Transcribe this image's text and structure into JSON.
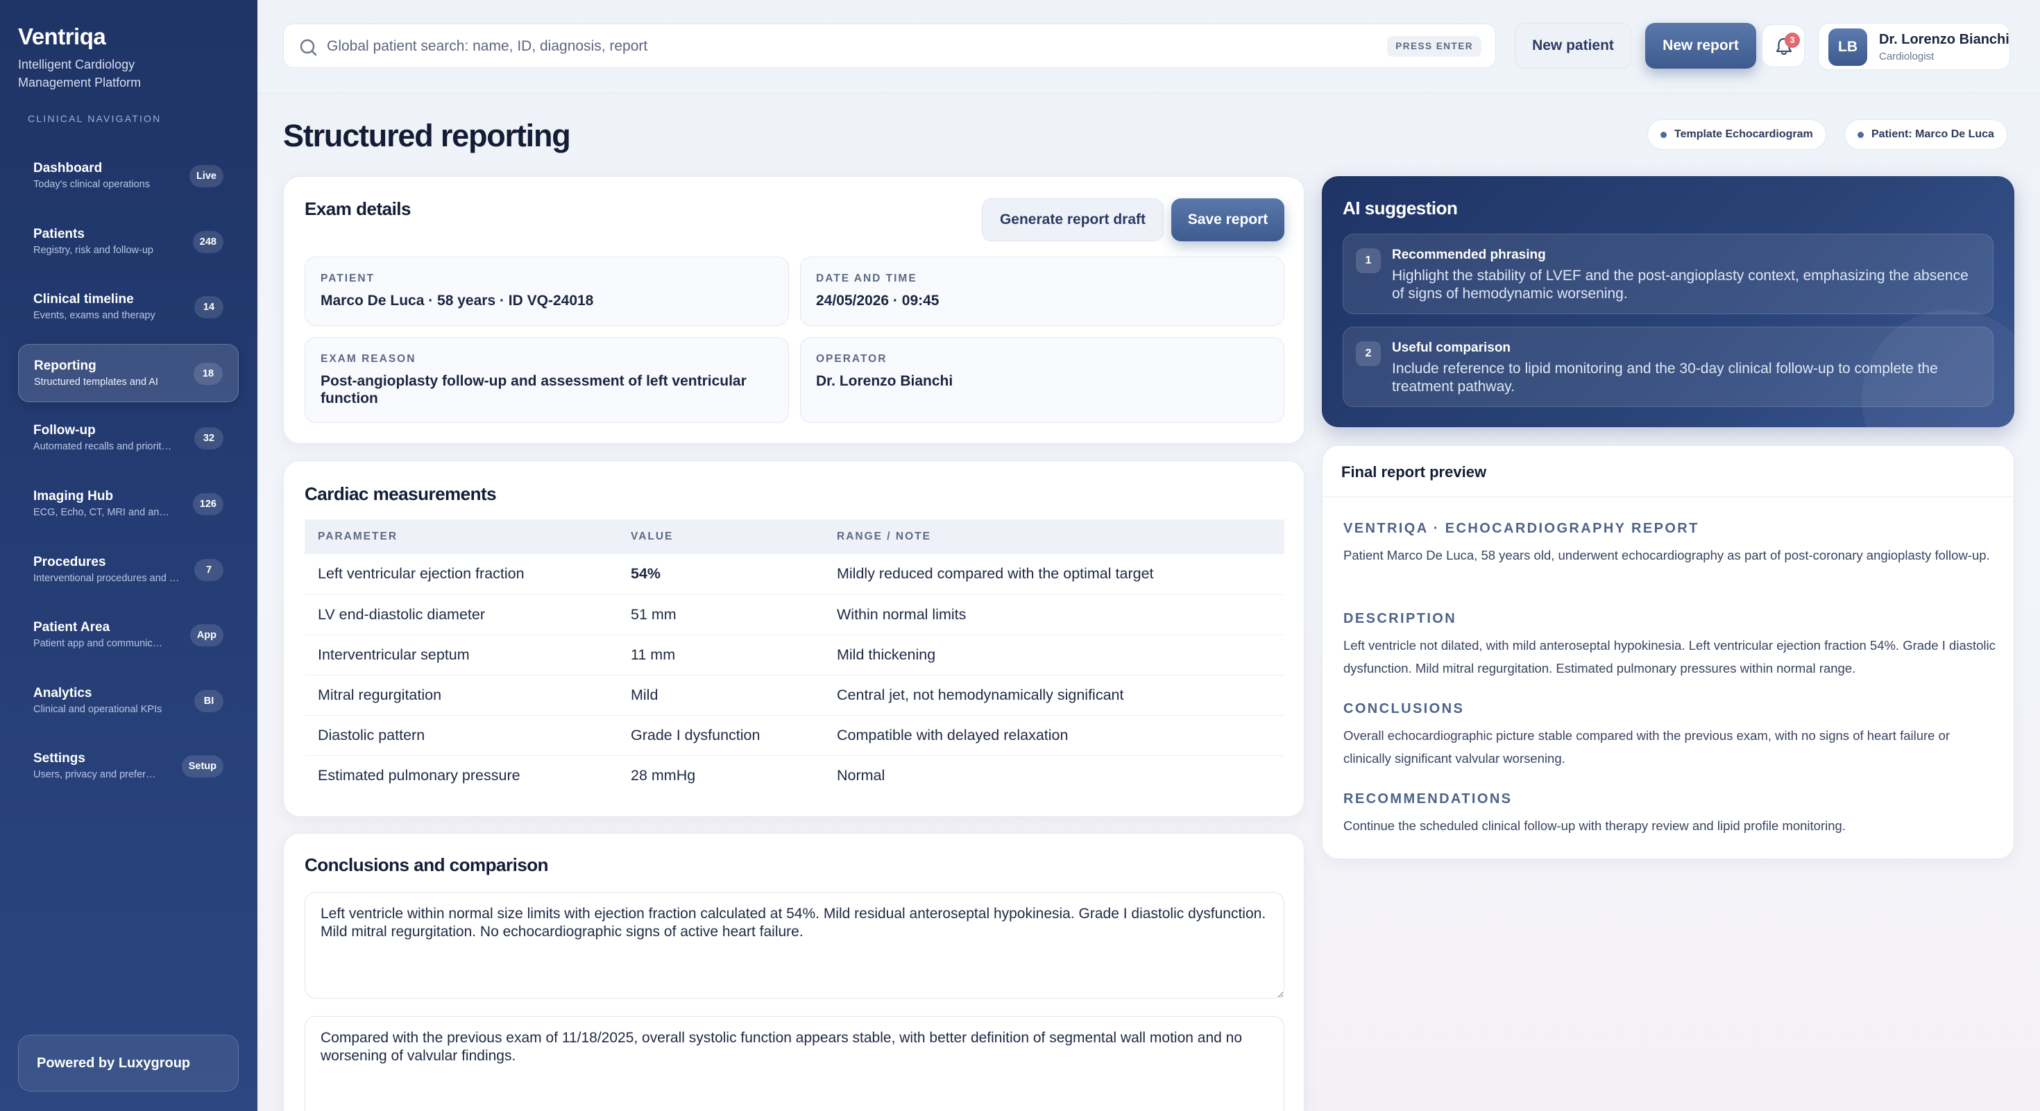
{
  "sidebar": {
    "brand": "Ventriqa",
    "tagline": "Intelligent Cardiology Management Platform",
    "nav_heading": "CLINICAL NAVIGATION",
    "items": [
      {
        "label": "Dashboard",
        "desc": "Today's clinical operations",
        "badge": "Live"
      },
      {
        "label": "Patients",
        "desc": "Registry, risk and follow-up",
        "badge": "248"
      },
      {
        "label": "Clinical timeline",
        "desc": "Events, exams and therapy",
        "badge": "14"
      },
      {
        "label": "Reporting",
        "desc": "Structured templates and AI",
        "badge": "18"
      },
      {
        "label": "Follow-up",
        "desc": "Automated recalls and priorit…",
        "badge": "32"
      },
      {
        "label": "Imaging Hub",
        "desc": "ECG, Echo, CT, MRI and an…",
        "badge": "126"
      },
      {
        "label": "Procedures",
        "desc": "Interventional procedures and …",
        "badge": "7"
      },
      {
        "label": "Patient Area",
        "desc": "Patient app and communic…",
        "badge": "App"
      },
      {
        "label": "Analytics",
        "desc": "Clinical and operational KPIs",
        "badge": "BI"
      },
      {
        "label": "Settings",
        "desc": "Users, privacy and prefer…",
        "badge": "Setup"
      }
    ],
    "active_index": 3,
    "powered_by": "Powered by Luxygroup"
  },
  "topbar": {
    "search_placeholder": "Global patient search: name, ID, diagnosis, report",
    "search_hint": "PRESS ENTER",
    "new_patient": "New patient",
    "new_report": "New report",
    "notification_count": "3",
    "user": {
      "initials": "LB",
      "name": "Dr. Lorenzo Bianchi",
      "role": "Cardiologist"
    }
  },
  "page": {
    "title": "Structured reporting",
    "chips": [
      "Template Echocardiogram",
      "Patient: Marco De Luca"
    ]
  },
  "exam": {
    "title": "Exam details",
    "generate_draft": "Generate report draft",
    "save_report": "Save report",
    "fields": [
      {
        "label": "PATIENT",
        "value": "Marco De Luca · 58 years · ID VQ-24018"
      },
      {
        "label": "DATE AND TIME",
        "value": "24/05/2026 · 09:45"
      },
      {
        "label": "EXAM REASON",
        "value": "Post-angioplasty follow-up and assessment of left ventricular function"
      },
      {
        "label": "OPERATOR",
        "value": "Dr. Lorenzo Bianchi"
      }
    ]
  },
  "measurements": {
    "title": "Cardiac measurements",
    "columns": [
      "PARAMETER",
      "VALUE",
      "RANGE / NOTE"
    ],
    "rows": [
      {
        "parameter": "Left ventricular ejection fraction",
        "value": "54%",
        "note": "Mildly reduced compared with the optimal target"
      },
      {
        "parameter": "LV end-diastolic diameter",
        "value": "51 mm",
        "note": "Within normal limits"
      },
      {
        "parameter": "Interventricular septum",
        "value": "11 mm",
        "note": "Mild thickening"
      },
      {
        "parameter": "Mitral regurgitation",
        "value": "Mild",
        "note": "Central jet, not hemodynamically significant"
      },
      {
        "parameter": "Diastolic pattern",
        "value": "Grade I dysfunction",
        "note": "Compatible with delayed relaxation"
      },
      {
        "parameter": "Estimated pulmonary pressure",
        "value": "28 mmHg",
        "note": "Normal"
      }
    ]
  },
  "conclusions": {
    "title": "Conclusions and comparison",
    "conclusion_text": "Left ventricle within normal size limits with ejection fraction calculated at 54%. Mild residual anteroseptal hypokinesia. Grade I diastolic dysfunction. Mild mitral regurgitation. No echocardiographic signs of active heart failure.",
    "comparison_text": "Compared with the previous exam of 11/18/2025, overall systolic function appears stable, with better definition of segmental wall motion and no worsening of valvular findings."
  },
  "ai": {
    "title": "AI suggestion",
    "suggestions": [
      {
        "num": "1",
        "head": "Recommended phrasing",
        "body": "Highlight the stability of LVEF and the post-angioplasty context, emphasizing the absence of signs of hemodynamic worsening."
      },
      {
        "num": "2",
        "head": "Useful comparison",
        "body": "Include reference to lipid monitoring and the 30-day clinical follow-up to complete the treatment pathway."
      }
    ]
  },
  "preview": {
    "title": "Final report preview",
    "report_heading": "VENTRIQA · ECHOCARDIOGRAPHY REPORT",
    "intro": "Patient Marco De Luca, 58 years old, underwent echocardiography as part of post-coronary angioplasty follow-up.",
    "description_heading": "DESCRIPTION",
    "description": "Left ventricle not dilated, with mild anteroseptal hypokinesia. Left ventricular ejection fraction 54%. Grade I diastolic dysfunction. Mild mitral regurgitation. Estimated pulmonary pressures within normal range.",
    "conclusions_heading": "CONCLUSIONS",
    "conclusions": "Overall echocardiographic picture stable compared with the previous exam, with no signs of heart failure or clinically significant valvular worsening.",
    "recommendations_heading": "RECOMMENDATIONS",
    "recommendations": "Continue the scheduled clinical follow-up with therapy review and lipid profile monitoring."
  }
}
